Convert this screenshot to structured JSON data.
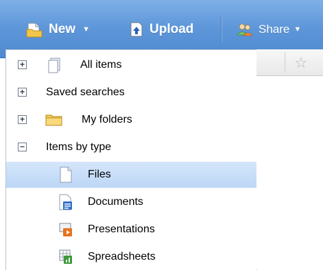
{
  "toolbar": {
    "new_label": "New",
    "new_dropdown_icon": "caret-down",
    "upload_label": "Upload",
    "share_label": "Share",
    "share_dropdown_icon": "caret-down"
  },
  "sidebar": {
    "items": [
      {
        "label": "All items",
        "toggle": "+",
        "icon": "document-stack-icon"
      },
      {
        "label": "Saved searches",
        "toggle": "+",
        "icon": ""
      },
      {
        "label": "My folders",
        "toggle": "+",
        "icon": "folder-icon"
      },
      {
        "label": "Items by type",
        "toggle": "−",
        "icon": ""
      },
      {
        "label": "Files",
        "icon": "file-icon",
        "selected": true
      },
      {
        "label": "Documents",
        "icon": "document-icon"
      },
      {
        "label": "Presentations",
        "icon": "presentation-icon"
      },
      {
        "label": "Spreadsheets",
        "icon": "spreadsheet-icon"
      }
    ]
  },
  "right_panel": {
    "star_glyph": "☆"
  },
  "colors": {
    "toolbar": "#5f98da",
    "selected_row": "#c7ddf8",
    "border": "#b9c3cf"
  }
}
